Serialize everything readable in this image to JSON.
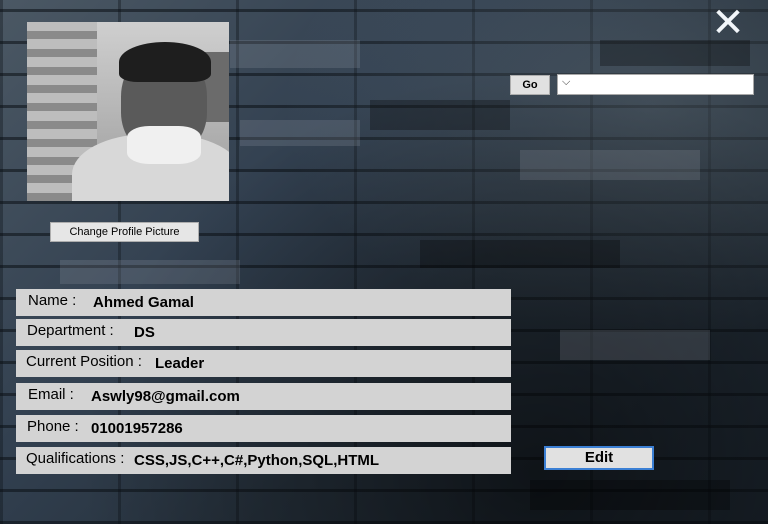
{
  "window": {
    "close_glyph": "✕"
  },
  "profile": {
    "change_picture_label": "Change Profile Picture"
  },
  "search": {
    "go_label": "Go",
    "combo_value": "",
    "chevron_glyph": "⌵"
  },
  "fields": [
    {
      "label": "Name :",
      "value": "Ahmed Gamal"
    },
    {
      "label": "Department :",
      "value": "DS"
    },
    {
      "label": "Current Position :",
      "value": "Leader"
    },
    {
      "label": "Email :",
      "value": "Aswly98@gmail.com"
    },
    {
      "label": "Phone :",
      "value": "01001957286"
    },
    {
      "label": "Qualifications :",
      "value": "CSS,JS,C++,C#,Python,SQL,HTML"
    }
  ],
  "actions": {
    "edit_label": "Edit"
  },
  "colors": {
    "field_bg": "#d3d3d3",
    "edit_border": "#3b7fd4",
    "close_icon": "#f2f6fa"
  }
}
